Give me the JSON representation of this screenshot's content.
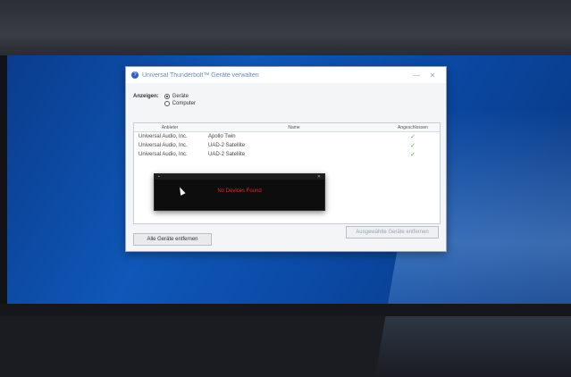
{
  "dialog": {
    "title": "Universal Thunderbolt™ Geräte verwalten",
    "minimize": "—",
    "close": "✕"
  },
  "show": {
    "label": "Anzeigen:",
    "options": [
      "Geräte",
      "Computer"
    ],
    "selected": "Geräte"
  },
  "list": {
    "headers": [
      "Anbieter",
      "Name",
      "Angeschlossen"
    ],
    "rows": [
      {
        "vendor": "Universal Audio, Inc.",
        "name": "Apollo Twin",
        "connected": "✓"
      },
      {
        "vendor": "Universal Audio, Inc.",
        "name": "UAD-2 Satellite",
        "connected": "✓"
      },
      {
        "vendor": "Universal Audio, Inc.",
        "name": "UAD-2 Satellite",
        "connected": "✓"
      }
    ]
  },
  "popup": {
    "title": "",
    "message": "No Devices Found"
  },
  "buttons": {
    "remove_all": "Alle Geräte entfernen",
    "remove_selected": "Ausgewählte Geräte entfernen"
  }
}
